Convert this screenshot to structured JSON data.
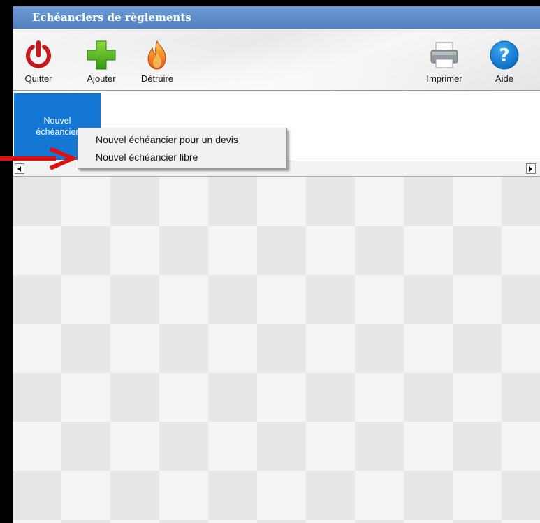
{
  "window": {
    "title": "Echéanciers de règlements"
  },
  "toolbar": {
    "quit": {
      "label": "Quitter",
      "icon": "power-icon"
    },
    "add": {
      "label": "Ajouter",
      "icon": "plus-icon"
    },
    "destroy": {
      "label": "Détruire",
      "icon": "fire-icon"
    },
    "print": {
      "label": "Imprimer",
      "icon": "printer-icon"
    },
    "help": {
      "label": "Aide",
      "icon": "help-icon"
    }
  },
  "tabs": {
    "new_tab": {
      "line1": "Nouvel",
      "line2": "échéancier"
    }
  },
  "context_menu": {
    "items": [
      {
        "label": "Nouvel échéancier pour un devis"
      },
      {
        "label": "Nouvel échéancier libre"
      }
    ]
  },
  "colors": {
    "title_bar": "#5a8ac8",
    "tab_selected": "#1477d4",
    "annotation_arrow": "#e01010"
  }
}
